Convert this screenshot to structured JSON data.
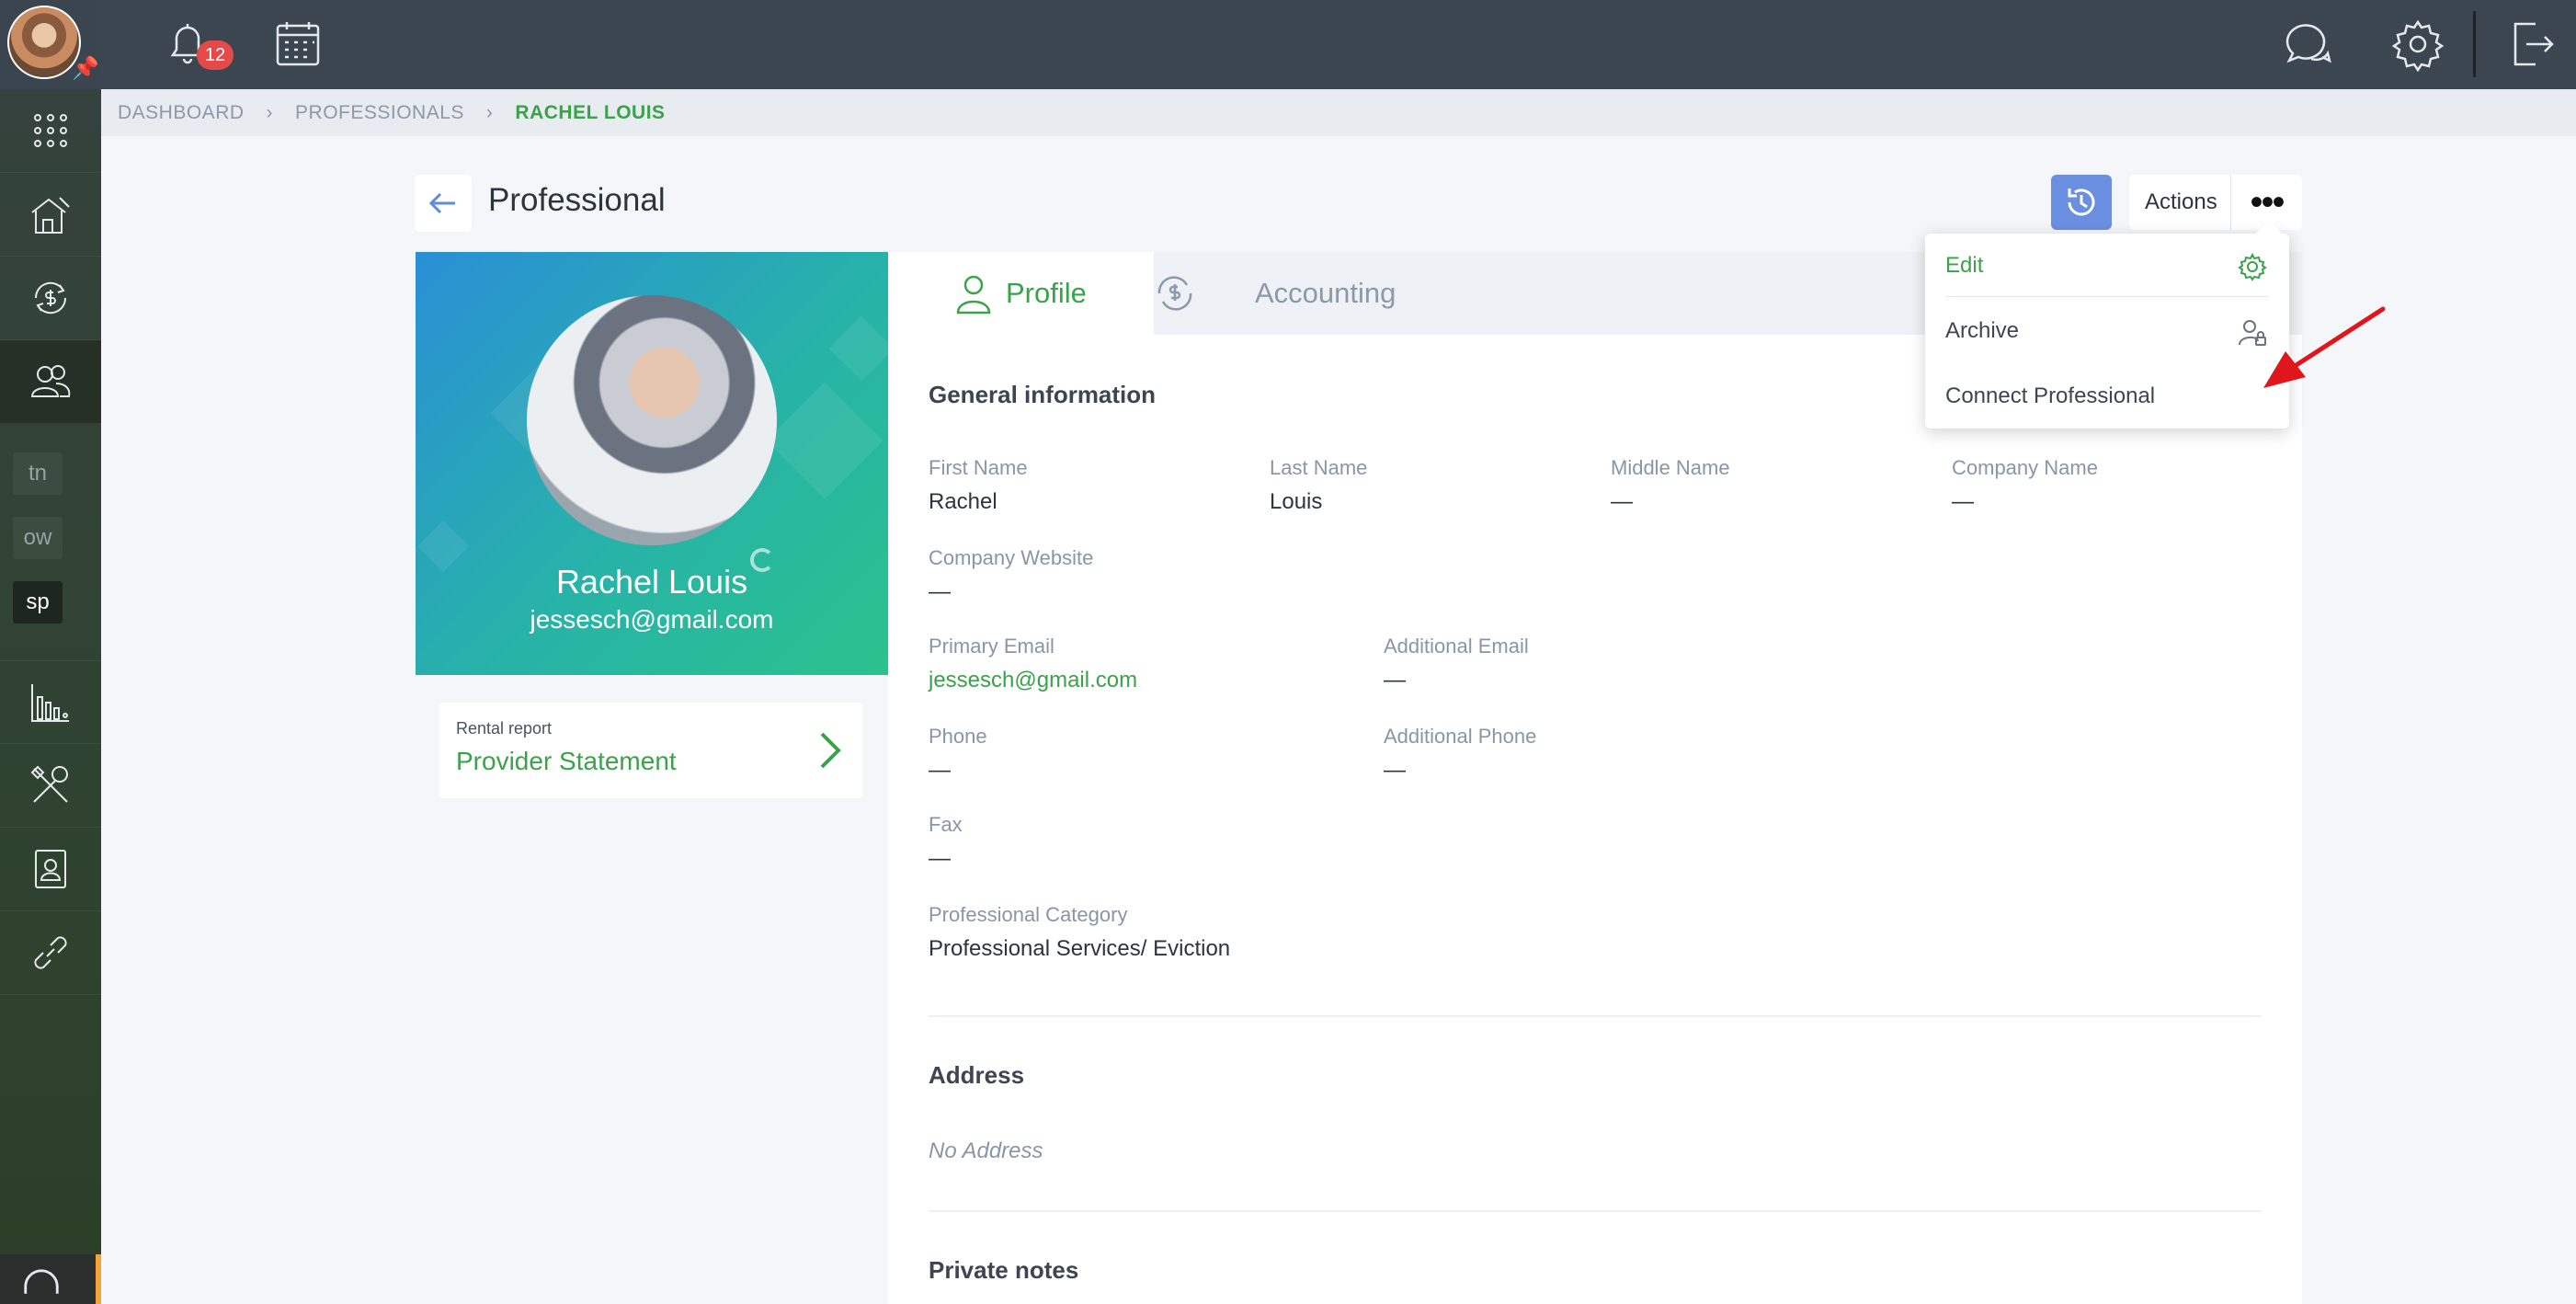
{
  "topbar": {
    "notification_count": "12"
  },
  "sidebar": {
    "items": [
      {
        "icon": "apps-grid-icon"
      },
      {
        "icon": "home-icon"
      },
      {
        "icon": "money-cycle-icon"
      },
      {
        "icon": "people-icon"
      },
      {
        "icon": "bar-chart-icon"
      },
      {
        "icon": "tools-icon"
      },
      {
        "icon": "contact-card-icon"
      },
      {
        "icon": "link-icon"
      }
    ],
    "shortcuts": [
      "tn",
      "ow",
      "sp"
    ]
  },
  "breadcrumb": {
    "items": [
      "DASHBOARD",
      "PROFESSIONALS",
      "RACHEL LOUIS"
    ]
  },
  "header": {
    "title": "Professional",
    "actions_label": "Actions",
    "more_label": "•••"
  },
  "profile_card": {
    "name": "Rachel Louis",
    "email": "jessesch@gmail.com"
  },
  "report": {
    "label": "Rental report",
    "title": "Provider Statement"
  },
  "tabs": [
    {
      "label": "Profile",
      "active": true
    },
    {
      "label": "Accounting",
      "active": false
    }
  ],
  "general": {
    "title": "General information",
    "first_name": {
      "label": "First Name",
      "value": "Rachel"
    },
    "last_name": {
      "label": "Last Name",
      "value": "Louis"
    },
    "middle_name": {
      "label": "Middle Name",
      "value": "—"
    },
    "company_name": {
      "label": "Company Name",
      "value": "—"
    },
    "company_website": {
      "label": "Company Website",
      "value": "—"
    },
    "primary_email": {
      "label": "Primary Email",
      "value": "jessesch@gmail.com"
    },
    "additional_email": {
      "label": "Additional Email",
      "value": "—"
    },
    "phone": {
      "label": "Phone",
      "value": "—"
    },
    "additional_phone": {
      "label": "Additional Phone",
      "value": "—"
    },
    "fax": {
      "label": "Fax",
      "value": "—"
    },
    "category": {
      "label": "Professional Category",
      "value": "Professional Services/ Eviction"
    }
  },
  "address": {
    "title": "Address",
    "value": "No Address"
  },
  "notes": {
    "title": "Private notes"
  },
  "dropdown": {
    "items": [
      {
        "label": "Edit",
        "icon": "gear-icon"
      },
      {
        "label": "Archive",
        "icon": "user-lock-icon"
      },
      {
        "label": "Connect Professional"
      }
    ]
  },
  "colors": {
    "accent_green": "#3aa34a",
    "accent_blue": "#6b8fe0",
    "sidebar": "#2f4331",
    "topbar": "#3b4650",
    "arrow_red": "#e0161d"
  }
}
